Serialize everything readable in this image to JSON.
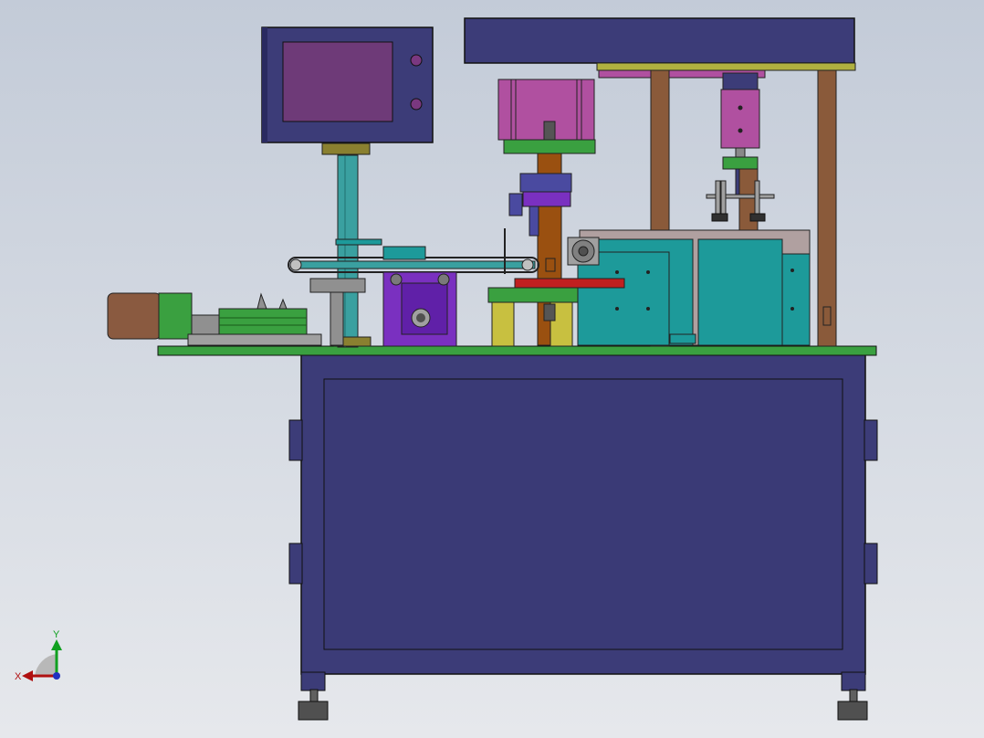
{
  "viewport": {
    "background": "#d0d6df"
  },
  "triad": {
    "x_label": "X",
    "y_label": "Y",
    "x_color": "#b01010",
    "y_color": "#10a020",
    "z_color": "#2030c0"
  },
  "colors": {
    "frame": "#3c3c78",
    "frame_inner": "#3a3a76",
    "plate": "#3aa040",
    "magenta": "#b050a0",
    "purple": "#7a30c0",
    "teal": "#1d9a9a",
    "post": "#8a5a3a",
    "motor": "#8a5a40",
    "yellow": "#c8c040",
    "red": "#c02020",
    "steel": "#909090",
    "screen": "#6e3a78"
  }
}
